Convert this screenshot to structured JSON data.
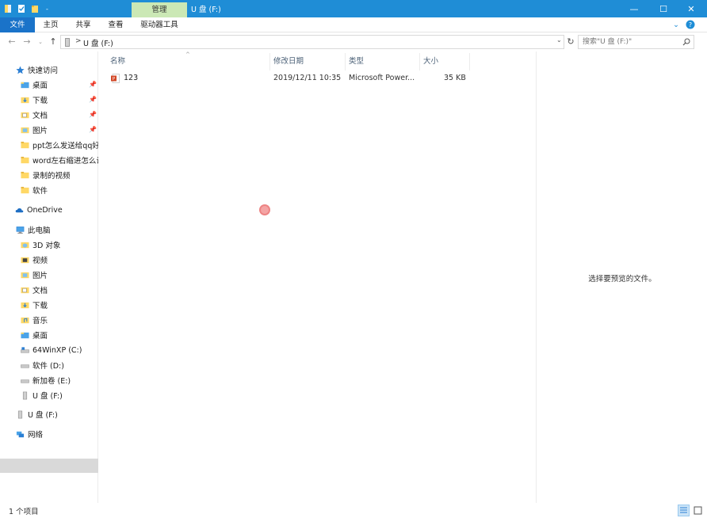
{
  "titlebar": {
    "manage_tab": "管理",
    "title": "U 盘 (F:)",
    "minimize": "—",
    "maximize": "☐",
    "close": "✕"
  },
  "ribbon": {
    "tabs": [
      "文件",
      "主页",
      "共享",
      "查看",
      "驱动器工具"
    ],
    "help": "?",
    "chevron": "⌄"
  },
  "address": {
    "path": "U 盘 (F:)",
    "separator": ">",
    "search_placeholder": "搜索\"U 盘 (F:)\""
  },
  "nav": {
    "quick_access": "快速访问",
    "quick_items": [
      "桌面",
      "下载",
      "文档",
      "图片",
      "ppt怎么发送给qq好",
      "word左右缩进怎么设",
      "录制的视频",
      "软件"
    ],
    "onedrive": "OneDrive",
    "this_pc": "此电脑",
    "pc_items": [
      "3D 对象",
      "视频",
      "图片",
      "文档",
      "下载",
      "音乐",
      "桌面",
      "64WinXP  (C:)",
      "软件 (D:)",
      "新加卷 (E:)",
      "U 盘 (F:)"
    ],
    "usb": "U 盘 (F:)",
    "network": "网络"
  },
  "columns": {
    "name": "名称",
    "modified": "修改日期",
    "type": "类型",
    "size": "大小"
  },
  "files": [
    {
      "name": "123",
      "modified": "2019/12/11 10:35",
      "type": "Microsoft Power...",
      "size": "35 KB"
    }
  ],
  "preview": {
    "message": "选择要预览的文件。"
  },
  "status": {
    "count": "1 个项目"
  },
  "colors": {
    "titlebar": "#1f8dd6",
    "file_tab": "#1a73c9",
    "manage_tab": "#cbe8b5",
    "selected": "#d9d9d9"
  }
}
